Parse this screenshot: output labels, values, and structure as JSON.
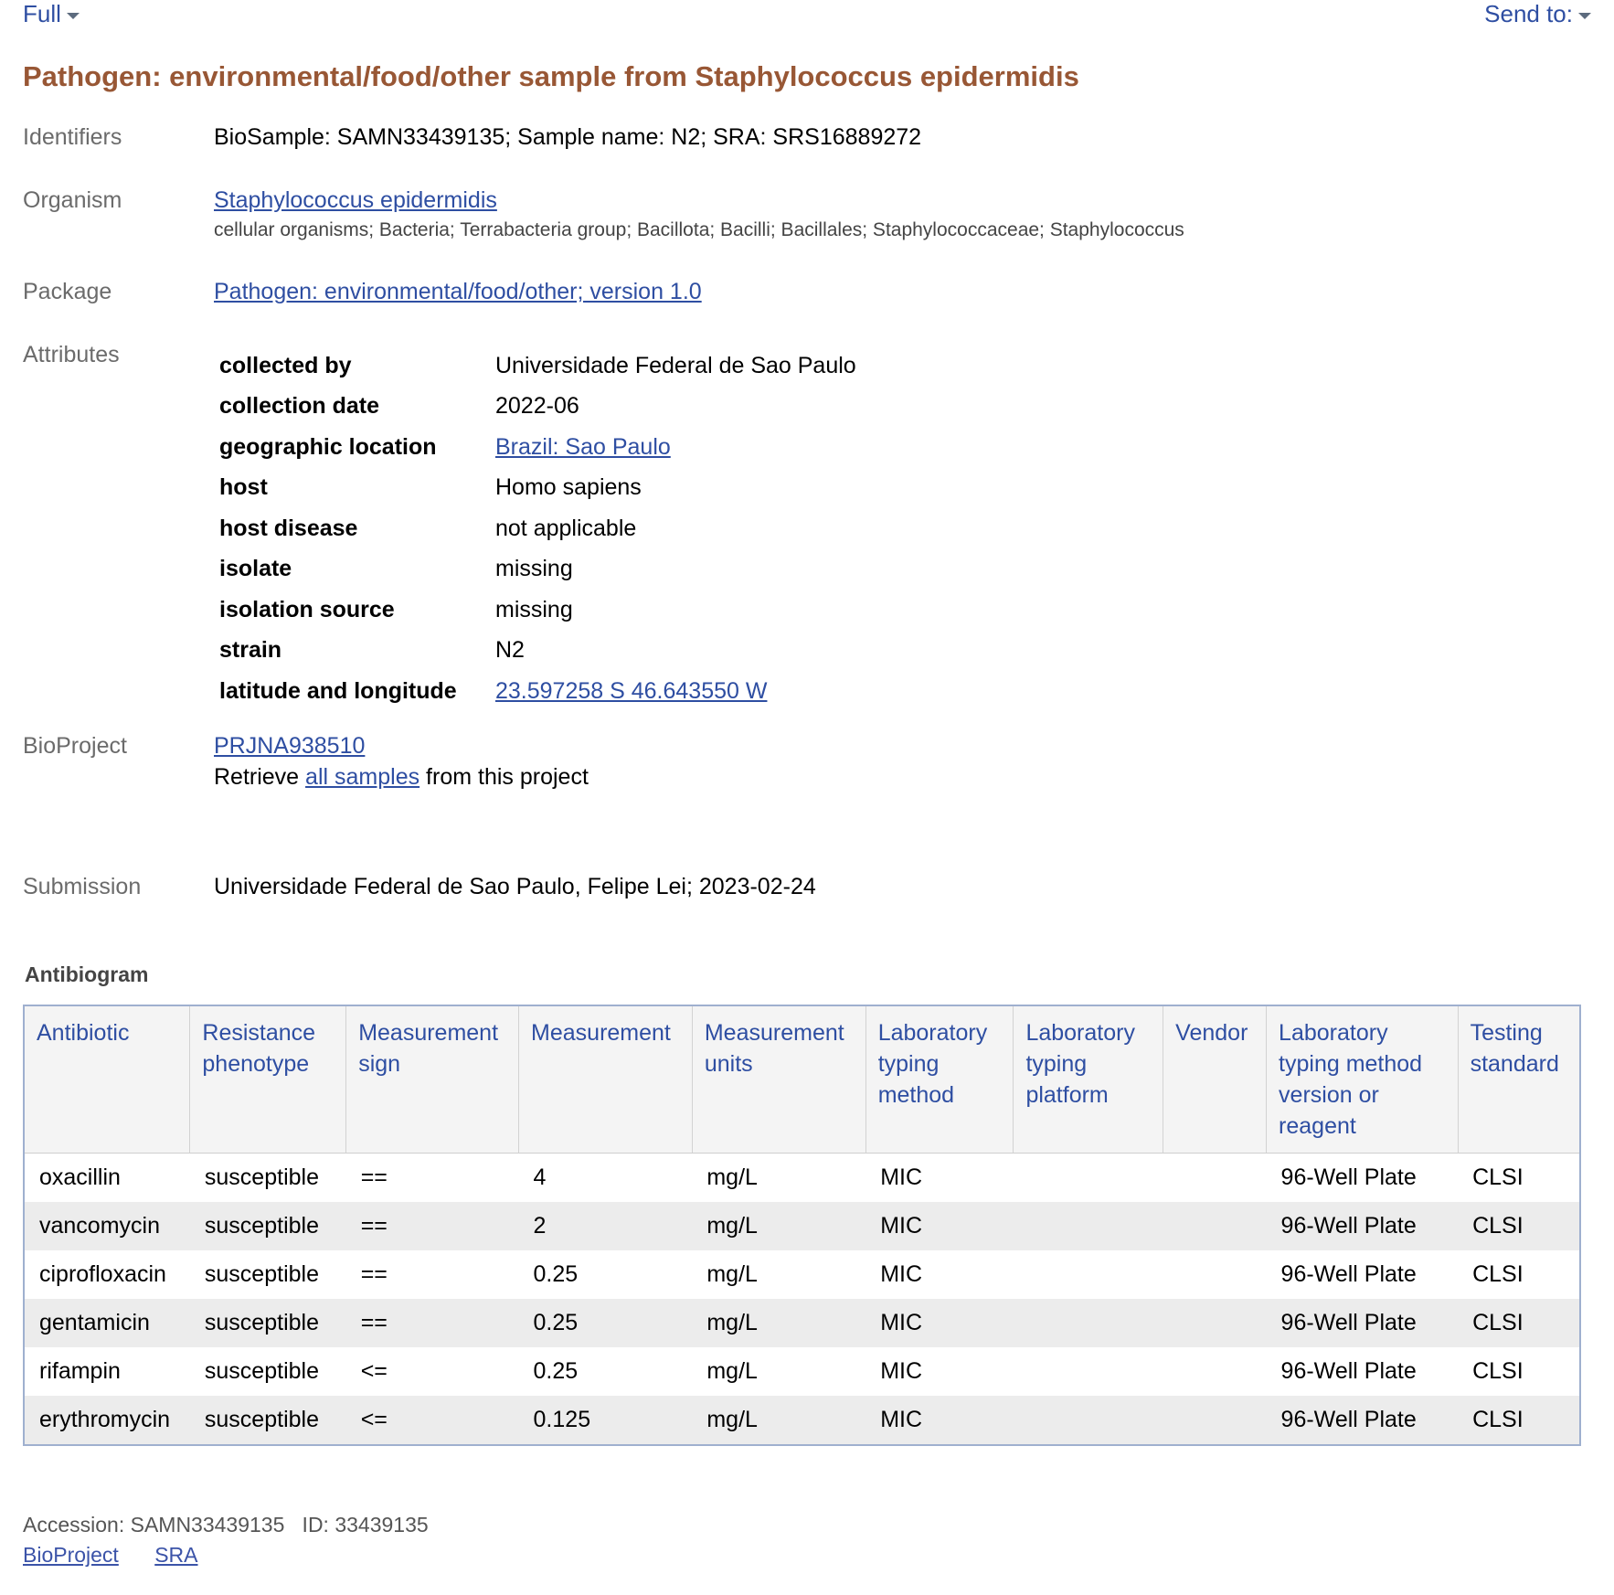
{
  "topbar": {
    "format_label": "Full",
    "send_to_label": "Send to:"
  },
  "title": "Pathogen: environmental/food/other sample from Staphylococcus epidermidis",
  "identifiers": {
    "label": "Identifiers",
    "value": "BioSample: SAMN33439135; Sample name: N2; SRA: SRS16889272"
  },
  "organism": {
    "label": "Organism",
    "name": "Staphylococcus epidermidis",
    "lineage": "cellular organisms; Bacteria; Terrabacteria group; Bacillota; Bacilli; Bacillales; Staphylococcaceae; Staphylococcus"
  },
  "package": {
    "label": "Package",
    "value": "Pathogen: environmental/food/other; version 1.0"
  },
  "attributes": {
    "label": "Attributes",
    "rows": [
      {
        "key": "collected by",
        "value": "Universidade Federal de Sao Paulo",
        "link": false
      },
      {
        "key": "collection date",
        "value": "2022-06",
        "link": false
      },
      {
        "key": "geographic location",
        "value": "Brazil: Sao Paulo",
        "link": true
      },
      {
        "key": "host",
        "value": "Homo sapiens",
        "link": false
      },
      {
        "key": "host disease",
        "value": "not applicable",
        "link": false
      },
      {
        "key": "isolate",
        "value": "missing",
        "link": false
      },
      {
        "key": "isolation source",
        "value": "missing",
        "link": false
      },
      {
        "key": "strain",
        "value": "N2",
        "link": false
      },
      {
        "key": "latitude and longitude",
        "value": "23.597258 S 46.643550 W",
        "link": true
      }
    ]
  },
  "bioproject": {
    "label": "BioProject",
    "id": "PRJNA938510",
    "retrieve_prefix": "Retrieve ",
    "retrieve_link": "all samples",
    "retrieve_suffix": " from this project"
  },
  "submission": {
    "label": "Submission",
    "value": "Universidade Federal de Sao Paulo, Felipe Lei; 2023-02-24"
  },
  "antibiogram": {
    "title": "Antibiogram",
    "headers": [
      "Antibiotic",
      "Resistance phenotype",
      "Measurement sign",
      "Measurement",
      "Measurement units",
      "Laboratory typing method",
      "Laboratory typing platform",
      "Vendor",
      "Laboratory typing method version or reagent",
      "Testing standard"
    ],
    "rows": [
      [
        "oxacillin",
        "susceptible",
        "==",
        "4",
        "mg/L",
        "MIC",
        "",
        "",
        "96-Well Plate",
        "CLSI"
      ],
      [
        "vancomycin",
        "susceptible",
        "==",
        "2",
        "mg/L",
        "MIC",
        "",
        "",
        "96-Well Plate",
        "CLSI"
      ],
      [
        "ciprofloxacin",
        "susceptible",
        "==",
        "0.25",
        "mg/L",
        "MIC",
        "",
        "",
        "96-Well Plate",
        "CLSI"
      ],
      [
        "gentamicin",
        "susceptible",
        "==",
        "0.25",
        "mg/L",
        "MIC",
        "",
        "",
        "96-Well Plate",
        "CLSI"
      ],
      [
        "rifampin",
        "susceptible",
        "<=",
        "0.25",
        "mg/L",
        "MIC",
        "",
        "",
        "96-Well Plate",
        "CLSI"
      ],
      [
        "erythromycin",
        "susceptible",
        "<=",
        "0.125",
        "mg/L",
        "MIC",
        "",
        "",
        "96-Well Plate",
        "CLSI"
      ]
    ]
  },
  "footer": {
    "accession": "Accession: SAMN33439135   ID: 33439135",
    "links": [
      "BioProject",
      "SRA"
    ]
  },
  "colors": {
    "title": "#985735",
    "link": "#2e4ea2",
    "label": "#6b6b6b",
    "table_border": "#9fb0cf",
    "row_alt": "#ececec"
  }
}
